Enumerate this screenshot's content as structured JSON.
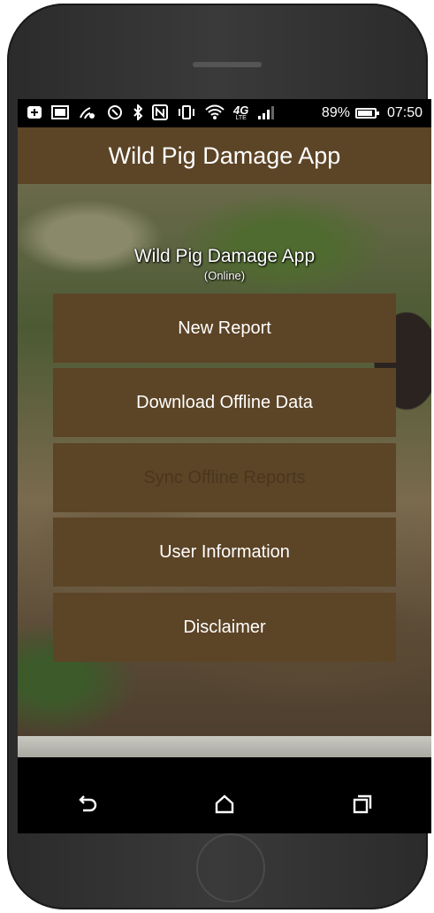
{
  "status_bar": {
    "icons": [
      "add-icon",
      "image-icon",
      "wifi-calling-icon",
      "nfc-call-icon",
      "bluetooth-icon",
      "nfc-icon",
      "vibrate-icon",
      "wifi-icon",
      "4g-lte-icon",
      "signal-icon"
    ],
    "network_label": "4G",
    "network_sublabel": "LTE",
    "battery_percent": "89%",
    "battery_level": 0.89,
    "time": "07:50"
  },
  "app_bar": {
    "title": "Wild Pig Damage App"
  },
  "main": {
    "overlay_title": "Wild Pig Damage App",
    "connection_status": "(Online)",
    "buttons": [
      {
        "label": "New Report",
        "enabled": true
      },
      {
        "label": "Download Offline Data",
        "enabled": true
      },
      {
        "label": "Sync Offline Reports",
        "enabled": false
      },
      {
        "label": "User Information",
        "enabled": true
      },
      {
        "label": "Disclaimer",
        "enabled": true
      }
    ]
  },
  "nav_bar": {
    "icons": [
      "back-icon",
      "home-icon",
      "recents-icon"
    ]
  },
  "colors": {
    "accent": "#5c4426",
    "disabled_text": "#4a361e"
  }
}
